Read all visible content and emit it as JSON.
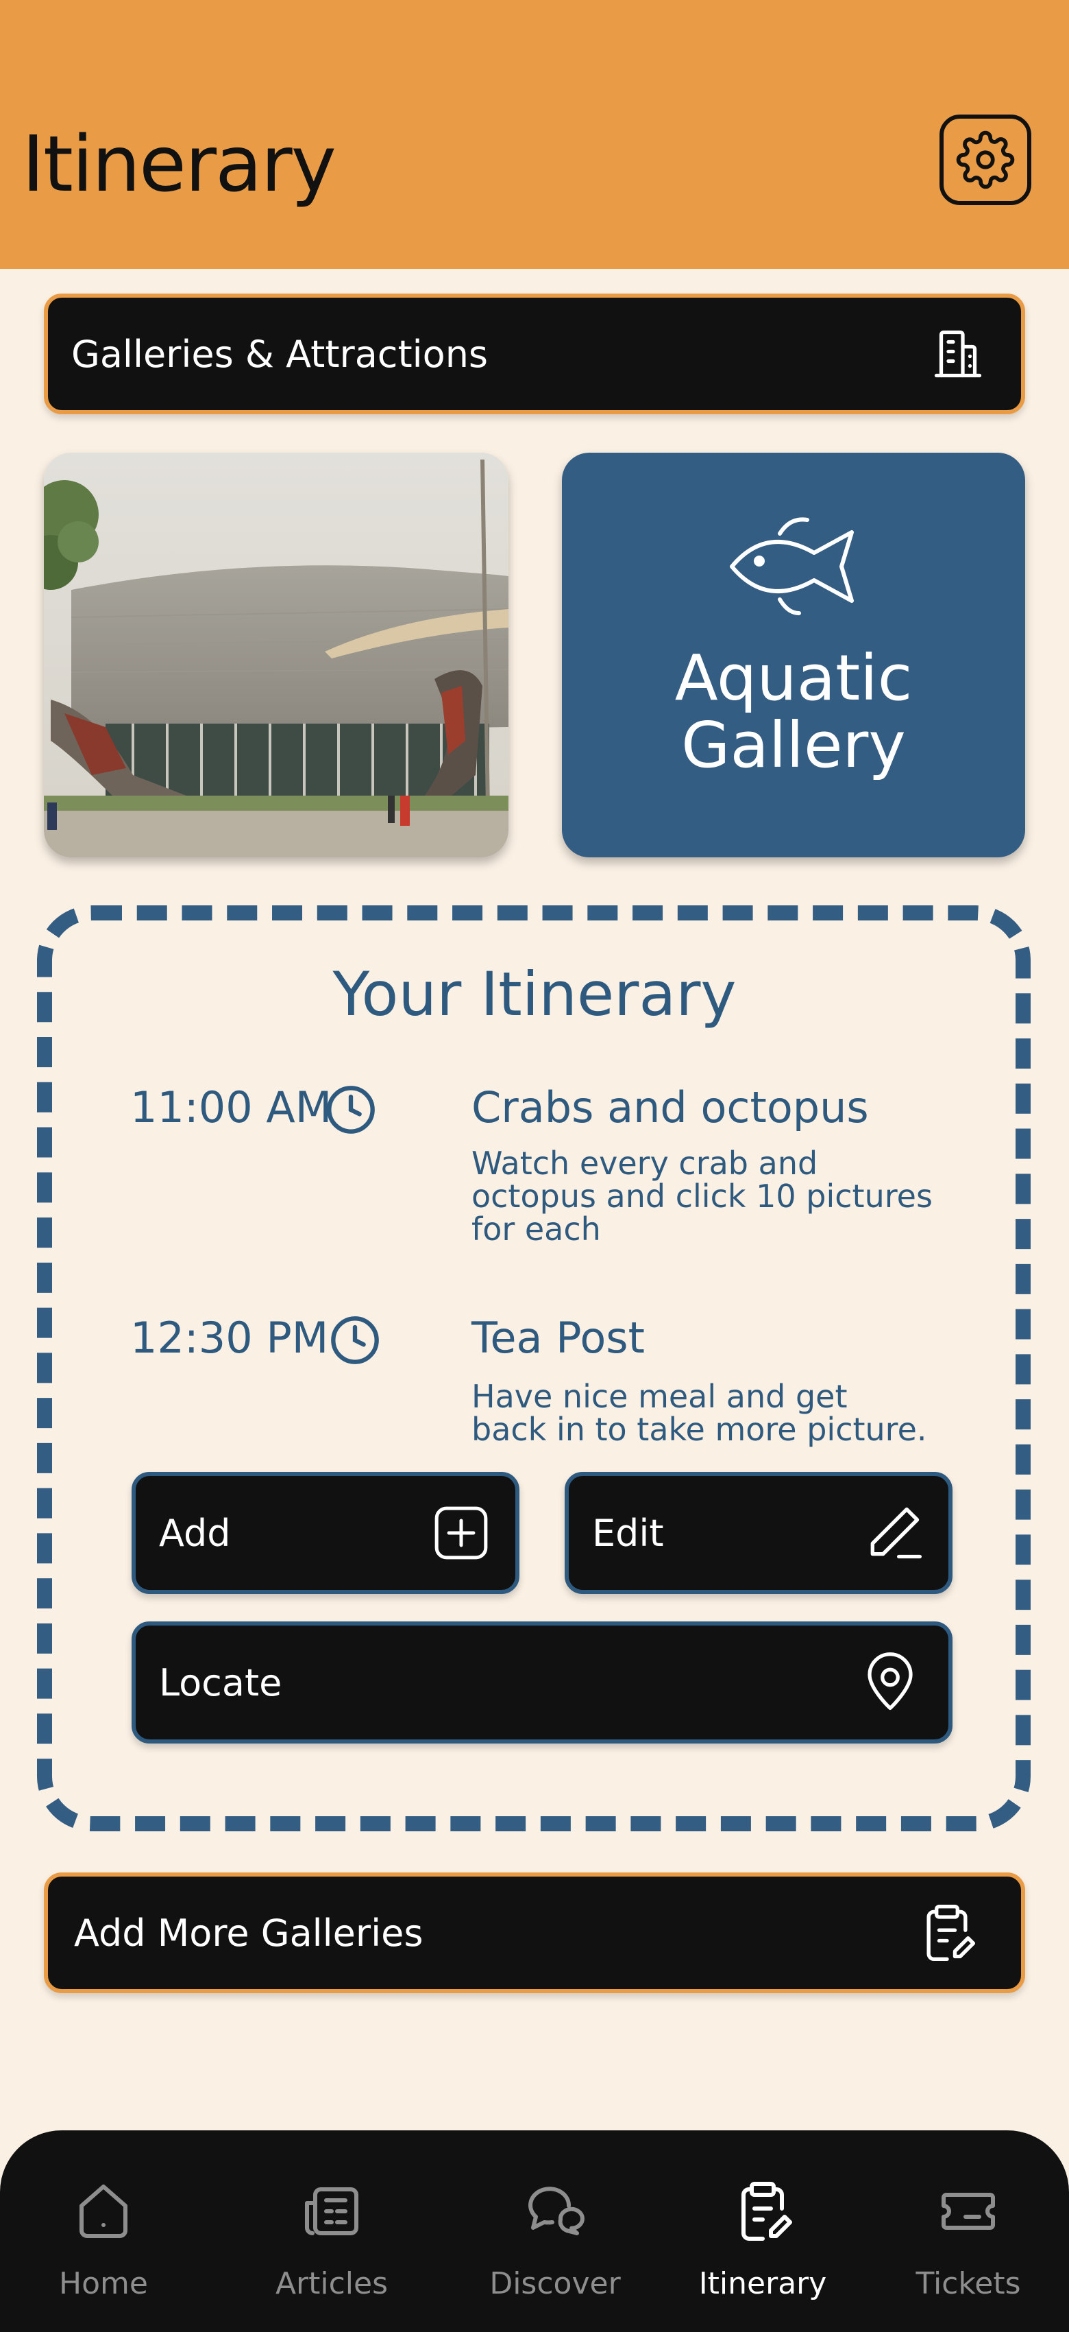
{
  "header": {
    "title": "Itinerary",
    "settings_icon": "gear-icon"
  },
  "galleries_bar": {
    "label": "Galleries & Attractions",
    "icon": "building-icon"
  },
  "featured": {
    "photo_alt": "Gallery exterior photo",
    "aquatic_card": {
      "title_line1": "Aquatic",
      "title_line2": "Gallery",
      "icon": "fish-icon"
    }
  },
  "itinerary": {
    "heading": "Your Itinerary",
    "entries": [
      {
        "time": "11:00 AM",
        "title": "Crabs and octopus",
        "desc_lines": [
          "Watch every crab and",
          "octopus and click 10 pictures",
          "for each"
        ]
      },
      {
        "time": "12:30 PM",
        "title": "Tea Post",
        "desc_lines": [
          "Have nice meal and get",
          "back in to take more picture."
        ]
      }
    ],
    "actions": {
      "add_label": "Add",
      "edit_label": "Edit",
      "locate_label": "Locate"
    }
  },
  "add_more": {
    "label": "Add More Galleries",
    "icon": "clipboard-edit-icon"
  },
  "nav": {
    "items": [
      {
        "label": "Home",
        "icon": "home-icon"
      },
      {
        "label": "Articles",
        "icon": "articles-icon"
      },
      {
        "label": "Discover",
        "icon": "chat-icon"
      },
      {
        "label": "Itinerary",
        "icon": "clipboard-edit-icon",
        "active": true
      },
      {
        "label": "Tickets",
        "icon": "ticket-icon"
      }
    ]
  },
  "colors": {
    "header": "#E99C45",
    "background": "#FAF0E4",
    "accent_blue": "#345D84",
    "dark": "#111111"
  }
}
